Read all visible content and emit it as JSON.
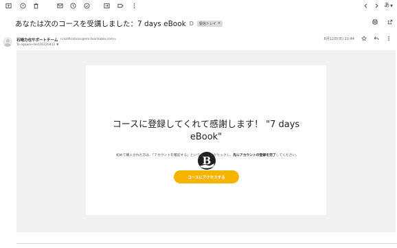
{
  "toolbar": {
    "icons": [
      "archive-icon",
      "report-spam-icon",
      "delete-icon",
      "mark-unread-icon",
      "snooze-icon",
      "add-task-icon",
      "move-to-icon",
      "labels-icon",
      "more-vert-icon"
    ],
    "nav": [
      "chevron-left-icon",
      "chevron-right-icon"
    ],
    "input_tool_label": "あ"
  },
  "message": {
    "subject": "あなたは次のコースを受講しました：7 days eBook",
    "importance_marker": "D",
    "label_chip": "受信トレイ",
    "label_remove": "×",
    "sender_name": "石崎力也サポートチーム",
    "sender_email": "<notifications@em.teachable.com>",
    "recipient": "To ogawa+test20220412",
    "date": "6月12日(日) 21:44"
  },
  "email_body": {
    "logo_letter": "B",
    "headline": "コースに登録してくれて感謝します！ \"7 days eBook\"",
    "para_part1": "初めて購入された方は、「アカウントを確認する」というメールをクリックし、",
    "para_bold1": "先にアカウントの登録を完了",
    "para_part2": "してください。",
    "cta_label": "コースにアクセスする"
  },
  "colors": {
    "cta": "#f4b400",
    "email_background": "#f1f1f1",
    "card": "#ffffff"
  }
}
